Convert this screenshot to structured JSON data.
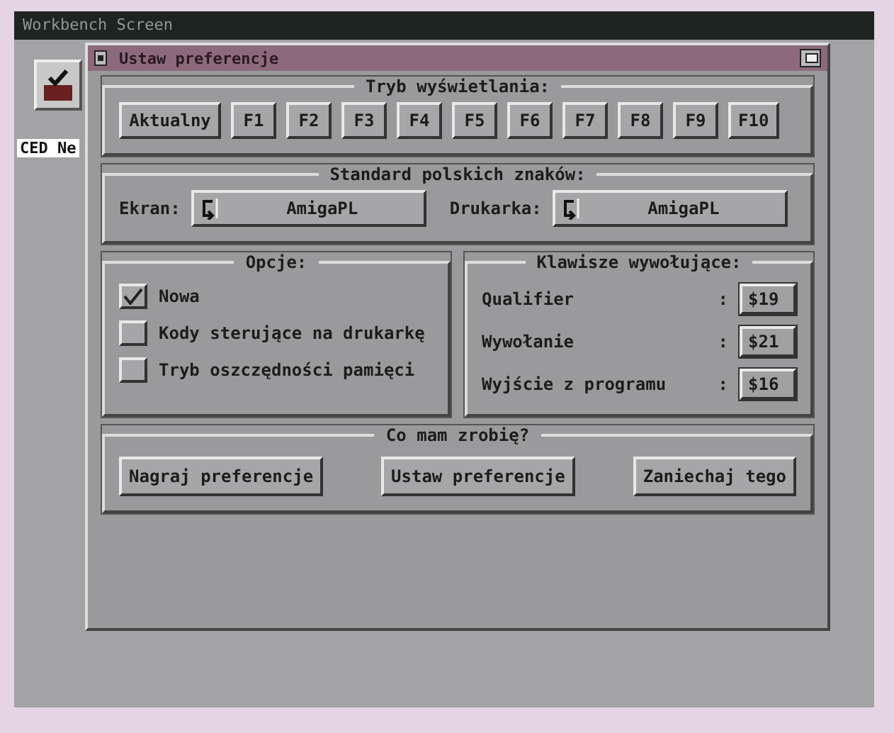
{
  "screen": {
    "title": "Workbench Screen"
  },
  "desktop_icon": {
    "label": "CED Ne"
  },
  "window": {
    "title": "Ustaw preferencje"
  },
  "display_mode": {
    "title": "Tryb wyświetlania:",
    "buttons": [
      "Aktualny",
      "F1",
      "F2",
      "F3",
      "F4",
      "F5",
      "F6",
      "F7",
      "F8",
      "F9",
      "F10"
    ]
  },
  "charset": {
    "title": "Standard polskich znaków:",
    "fields": [
      {
        "label": "Ekran:",
        "value": "AmigaPL"
      },
      {
        "label": "Drukarka:",
        "value": "AmigaPL"
      }
    ]
  },
  "options": {
    "title": "Opcje:",
    "items": [
      {
        "label": "Nowa",
        "checked": true
      },
      {
        "label": "Kody sterujące na drukarkę",
        "checked": false
      },
      {
        "label": "Tryb oszczędności pamięci",
        "checked": false
      }
    ]
  },
  "hotkeys": {
    "title": "Klawisze wywołujące:",
    "items": [
      {
        "label": "Qualifier",
        "separator": ":",
        "value": "$19"
      },
      {
        "label": "Wywołanie",
        "separator": ":",
        "value": "$21"
      },
      {
        "label": "Wyjście z programu",
        "separator": ":",
        "value": "$16"
      }
    ]
  },
  "actions": {
    "title": "Co mam zrobię?",
    "buttons": [
      "Nagraj preferencje",
      "Ustaw preferencje",
      "Zaniechaj tego"
    ]
  }
}
